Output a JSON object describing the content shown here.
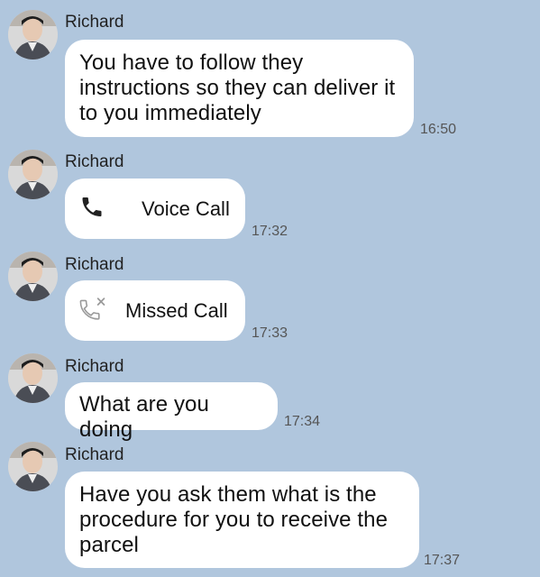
{
  "messages": [
    {
      "sender": "Richard",
      "type": "text",
      "text": "You have to follow  they\ninstructions so they can deliver it\nto you immediately",
      "time": "16:50"
    },
    {
      "sender": "Richard",
      "type": "call",
      "call_label": "Voice Call",
      "call_icon": "phone-icon",
      "time": "17:32"
    },
    {
      "sender": "Richard",
      "type": "call",
      "call_label": "Missed Call",
      "call_icon": "missed-call-icon",
      "time": "17:33"
    },
    {
      "sender": "Richard",
      "type": "text",
      "text": "What are you doing",
      "time": "17:34"
    },
    {
      "sender": "Richard",
      "type": "text",
      "text": "Have  you ask them what is the\nprocedure  for  you to receive  the\nparcel",
      "time": "17:37"
    }
  ],
  "colors": {
    "background": "#b0c6dd",
    "bubble": "#ffffff",
    "timestamp": "#555555",
    "missed_icon": "#9a9a9a"
  }
}
